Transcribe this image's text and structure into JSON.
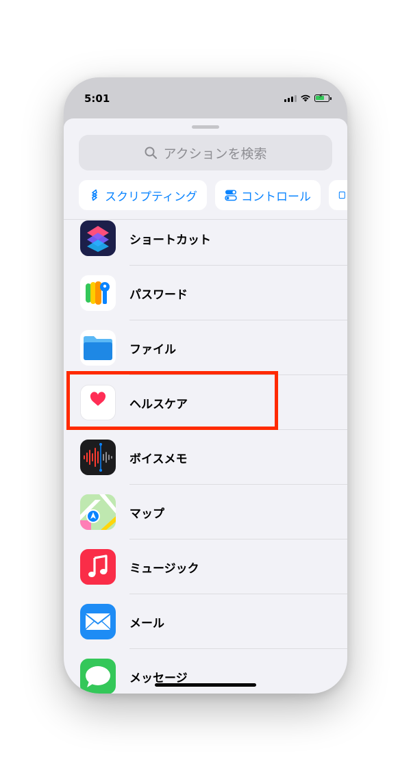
{
  "status_bar": {
    "time": "5:01"
  },
  "search": {
    "placeholder": "アクションを検索"
  },
  "categories": [
    {
      "label": "スクリプティング",
      "icon": "scripting-icon"
    },
    {
      "label": "コントロール",
      "icon": "control-toggle-icon"
    }
  ],
  "apps": [
    {
      "label": "ショートカット",
      "icon": "shortcuts-app-icon"
    },
    {
      "label": "パスワード",
      "icon": "passwords-app-icon"
    },
    {
      "label": "ファイル",
      "icon": "files-app-icon"
    },
    {
      "label": "ヘルスケア",
      "icon": "health-app-icon"
    },
    {
      "label": "ボイスメモ",
      "icon": "voice-memos-app-icon"
    },
    {
      "label": "マップ",
      "icon": "maps-app-icon"
    },
    {
      "label": "ミュージック",
      "icon": "music-app-icon"
    },
    {
      "label": "メール",
      "icon": "mail-app-icon"
    },
    {
      "label": "メッセージ",
      "icon": "messages-app-icon"
    }
  ],
  "highlight": {
    "color": "#ff2a00",
    "target": "ヘルスケア"
  },
  "colors": {
    "accent": "#0a84ff",
    "sheet_background": "#f2f2f7"
  }
}
